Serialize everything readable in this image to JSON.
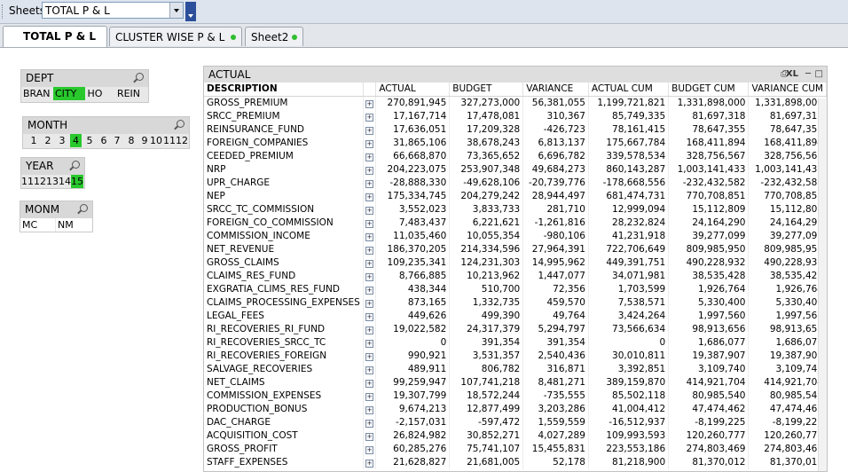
{
  "toolbar": {
    "sheets_label": "Sheets",
    "sheet_value": "TOTAL P & L"
  },
  "tabs": [
    {
      "label": "TOTAL P & L"
    },
    {
      "label": "CLUSTER WISE P & L"
    },
    {
      "label": "Sheet2"
    }
  ],
  "dept": {
    "title": "DEPT",
    "items": [
      "BRAN",
      "CITY",
      "HO",
      "REIN"
    ],
    "selected": "CITY"
  },
  "month": {
    "title": "MONTH",
    "items": [
      "1",
      "2",
      "3",
      "4",
      "5",
      "6",
      "7",
      "8",
      "9",
      "10",
      "11",
      "12"
    ],
    "selected": "4"
  },
  "year": {
    "title": "YEAR",
    "items": [
      "11",
      "12",
      "13",
      "14",
      "15"
    ],
    "selected": "15"
  },
  "monm": {
    "title": "MONM",
    "items": [
      "MC",
      "NM"
    ]
  },
  "table": {
    "title": "ACTUAL",
    "headers": [
      "DESCRIPTION",
      "ACTUAL",
      "BUDGET",
      "VARIANCE",
      "ACTUAL CUM",
      "BUDGET CUM",
      "VARIANCE CUM"
    ],
    "rows": [
      [
        "GROSS_PREMIUM",
        "270,891,945",
        "327,273,000",
        "56,381,055",
        "1,199,721,821",
        "1,331,898,000",
        "1,331,898,000"
      ],
      [
        "SRCC_PREMIUM",
        "17,167,714",
        "17,478,081",
        "310,367",
        "85,749,335",
        "81,697,318",
        "81,697,318"
      ],
      [
        "REINSURANCE_FUND",
        "17,636,051",
        "17,209,328",
        "-426,723",
        "78,161,415",
        "78,647,355",
        "78,647,355"
      ],
      [
        "FOREIGN_COMPANIES",
        "31,865,106",
        "38,678,243",
        "6,813,137",
        "175,667,784",
        "168,411,894",
        "168,411,894"
      ],
      [
        "CEEDED_PREMIUM",
        "66,668,870",
        "73,365,652",
        "6,696,782",
        "339,578,534",
        "328,756,567",
        "328,756,567"
      ],
      [
        "NRP",
        "204,223,075",
        "253,907,348",
        "49,684,273",
        "860,143,287",
        "1,003,141,433",
        "1,003,141,433"
      ],
      [
        "UPR_CHARGE",
        "-28,888,330",
        "-49,628,106",
        "-20,739,776",
        "-178,668,556",
        "-232,432,582",
        "-232,432,582"
      ],
      [
        "NEP",
        "175,334,745",
        "204,279,242",
        "28,944,497",
        "681,474,731",
        "770,708,851",
        "770,708,851"
      ],
      [
        "SRCC_TC_COMMISSION",
        "3,552,023",
        "3,833,733",
        "281,710",
        "12,999,094",
        "15,112,809",
        "15,112,809"
      ],
      [
        "FOREIGN_CO_COMMISSION",
        "7,483,437",
        "6,221,621",
        "-1,261,816",
        "28,232,824",
        "24,164,290",
        "24,164,290"
      ],
      [
        "COMMISSION_INCOME",
        "11,035,460",
        "10,055,354",
        "-980,106",
        "41,231,918",
        "39,277,099",
        "39,277,099"
      ],
      [
        "NET_REVENUE",
        "186,370,205",
        "214,334,596",
        "27,964,391",
        "722,706,649",
        "809,985,950",
        "809,985,950"
      ],
      [
        "GROSS_CLAIMS",
        "109,235,341",
        "124,231,303",
        "14,995,962",
        "449,391,751",
        "490,228,932",
        "490,228,932"
      ],
      [
        "CLAIMS_RES_FUND",
        "8,766,885",
        "10,213,962",
        "1,447,077",
        "34,071,981",
        "38,535,428",
        "38,535,428"
      ],
      [
        "EXGRATIA_CLIMS_RES_FUND",
        "438,344",
        "510,700",
        "72,356",
        "1,703,599",
        "1,926,764",
        "1,926,764"
      ],
      [
        "CLAIMS_PROCESSING_EXPENSES",
        "873,165",
        "1,332,735",
        "459,570",
        "7,538,571",
        "5,330,400",
        "5,330,400"
      ],
      [
        "LEGAL_FEES",
        "449,626",
        "499,390",
        "49,764",
        "3,424,264",
        "1,997,560",
        "1,997,560"
      ],
      [
        "RI_RECOVERIES_RI_FUND",
        "19,022,582",
        "24,317,379",
        "5,294,797",
        "73,566,634",
        "98,913,656",
        "98,913,656"
      ],
      [
        "RI_RECOVERIES_SRCC_TC",
        "0",
        "391,354",
        "391,354",
        "0",
        "1,686,077",
        "1,686,077"
      ],
      [
        "RI_RECOVERIES_FOREIGN",
        "990,921",
        "3,531,357",
        "2,540,436",
        "30,010,811",
        "19,387,907",
        "19,387,907"
      ],
      [
        "SALVAGE_RECOVERIES",
        "489,911",
        "806,782",
        "316,871",
        "3,392,851",
        "3,109,740",
        "3,109,740"
      ],
      [
        "NET_CLAIMS",
        "99,259,947",
        "107,741,218",
        "8,481,271",
        "389,159,870",
        "414,921,704",
        "414,921,704"
      ],
      [
        "COMMISSION_EXPENSES",
        "19,307,799",
        "18,572,244",
        "-735,555",
        "85,502,118",
        "80,985,540",
        "80,985,540"
      ],
      [
        "PRODUCTION_BONUS",
        "9,674,213",
        "12,877,499",
        "3,203,286",
        "41,004,412",
        "47,474,462",
        "47,474,462"
      ],
      [
        "DAC_CHARGE",
        "-2,157,031",
        "-597,472",
        "1,559,559",
        "-16,512,937",
        "-8,199,225",
        "-8,199,225"
      ],
      [
        "ACQUISITION_COST",
        "26,824,982",
        "30,852,271",
        "4,027,289",
        "109,993,593",
        "120,260,777",
        "120,260,777"
      ],
      [
        "GROSS_PROFIT",
        "60,285,276",
        "75,741,107",
        "15,455,831",
        "223,553,186",
        "274,803,469",
        "274,803,469"
      ],
      [
        "STAFF_EXPENSES",
        "21,628,827",
        "21,681,005",
        "52,178",
        "81,218,900",
        "81,370,012",
        "81,370,012"
      ]
    ]
  },
  "colors": {
    "selected": "#29c92d",
    "tab_dot": "#2fbd2f"
  }
}
